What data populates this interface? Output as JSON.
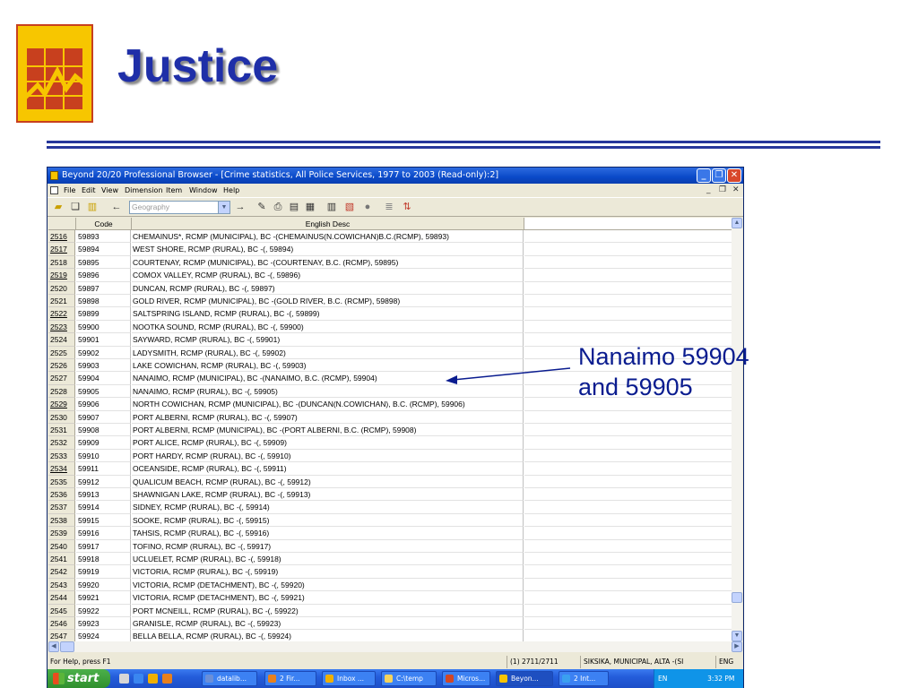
{
  "slide": {
    "title": "Justice",
    "callout_line1": "Nanaimo 59904",
    "callout_line2": "and 59905"
  },
  "window": {
    "title": "Beyond 20/20 Professional Browser - [Crime statistics, All Police Services, 1977 to 2003 (Read-only):2]",
    "menu": [
      "File",
      "Edit",
      "View",
      "Dimension",
      "Item",
      "Window",
      "Help"
    ],
    "dimension_combo": "Geography"
  },
  "grid": {
    "headers": {
      "code": "Code",
      "desc": "English Desc"
    },
    "rows": [
      {
        "num": "2516",
        "code": "59893",
        "desc": "CHEMAINUS*, RCMP (MUNICIPAL), BC -(CHEMAINUS(N.COWICHAN)B.C.(RCMP), 59893)",
        "link": true
      },
      {
        "num": "2517",
        "code": "59894",
        "desc": "WEST SHORE, RCMP (RURAL), BC -(, 59894)",
        "link": true
      },
      {
        "num": "2518",
        "code": "59895",
        "desc": "COURTENAY, RCMP (MUNICIPAL), BC -(COURTENAY, B.C. (RCMP), 59895)",
        "link": false
      },
      {
        "num": "2519",
        "code": "59896",
        "desc": "COMOX VALLEY, RCMP (RURAL), BC -(, 59896)",
        "link": true
      },
      {
        "num": "2520",
        "code": "59897",
        "desc": "DUNCAN, RCMP (RURAL), BC -(, 59897)",
        "link": false
      },
      {
        "num": "2521",
        "code": "59898",
        "desc": "GOLD RIVER, RCMP (MUNICIPAL), BC -(GOLD RIVER, B.C. (RCMP), 59898)",
        "link": false
      },
      {
        "num": "2522",
        "code": "59899",
        "desc": "SALTSPRING ISLAND, RCMP (RURAL), BC -(, 59899)",
        "link": true
      },
      {
        "num": "2523",
        "code": "59900",
        "desc": "NOOTKA SOUND, RCMP (RURAL), BC -(, 59900)",
        "link": true
      },
      {
        "num": "2524",
        "code": "59901",
        "desc": "SAYWARD, RCMP (RURAL), BC -(, 59901)",
        "link": false
      },
      {
        "num": "2525",
        "code": "59902",
        "desc": "LADYSMITH, RCMP (RURAL), BC -(, 59902)",
        "link": false
      },
      {
        "num": "2526",
        "code": "59903",
        "desc": "LAKE COWICHAN, RCMP (RURAL), BC -(, 59903)",
        "link": false
      },
      {
        "num": "2527",
        "code": "59904",
        "desc": "NANAIMO, RCMP (MUNICIPAL), BC -(NANAIMO, B.C. (RCMP), 59904)",
        "link": false
      },
      {
        "num": "2528",
        "code": "59905",
        "desc": "NANAIMO, RCMP (RURAL), BC -(, 59905)",
        "link": false
      },
      {
        "num": "2529",
        "code": "59906",
        "desc": "NORTH COWICHAN, RCMP (MUNICIPAL), BC -(DUNCAN(N.COWICHAN),  B.C. (RCMP), 59906)",
        "link": true
      },
      {
        "num": "2530",
        "code": "59907",
        "desc": "PORT ALBERNI, RCMP (RURAL), BC -(, 59907)",
        "link": false
      },
      {
        "num": "2531",
        "code": "59908",
        "desc": "PORT ALBERNI, RCMP (MUNICIPAL), BC -(PORT ALBERNI, B.C. (RCMP), 59908)",
        "link": false
      },
      {
        "num": "2532",
        "code": "59909",
        "desc": "PORT ALICE, RCMP (RURAL), BC -(, 59909)",
        "link": false
      },
      {
        "num": "2533",
        "code": "59910",
        "desc": "PORT HARDY, RCMP (RURAL), BC -(, 59910)",
        "link": false
      },
      {
        "num": "2534",
        "code": "59911",
        "desc": "OCEANSIDE, RCMP (RURAL), BC -(, 59911)",
        "link": true
      },
      {
        "num": "2535",
        "code": "59912",
        "desc": "QUALICUM BEACH, RCMP (RURAL), BC -(, 59912)",
        "link": false
      },
      {
        "num": "2536",
        "code": "59913",
        "desc": "SHAWNIGAN LAKE, RCMP (RURAL), BC -(, 59913)",
        "link": false
      },
      {
        "num": "2537",
        "code": "59914",
        "desc": "SIDNEY, RCMP (RURAL), BC -(, 59914)",
        "link": false
      },
      {
        "num": "2538",
        "code": "59915",
        "desc": "SOOKE, RCMP (RURAL), BC -(, 59915)",
        "link": false
      },
      {
        "num": "2539",
        "code": "59916",
        "desc": "TAHSIS, RCMP (RURAL), BC -(, 59916)",
        "link": false
      },
      {
        "num": "2540",
        "code": "59917",
        "desc": "TOFINO, RCMP (RURAL), BC -(, 59917)",
        "link": false
      },
      {
        "num": "2541",
        "code": "59918",
        "desc": "UCLUELET, RCMP (RURAL), BC -(, 59918)",
        "link": false
      },
      {
        "num": "2542",
        "code": "59919",
        "desc": "VICTORIA, RCMP (RURAL), BC -(, 59919)",
        "link": false
      },
      {
        "num": "2543",
        "code": "59920",
        "desc": "VICTORIA, RCMP (DETACHMENT), BC -(, 59920)",
        "link": false
      },
      {
        "num": "2544",
        "code": "59921",
        "desc": "VICTORIA, RCMP (DETACHMENT), BC -(, 59921)",
        "link": false
      },
      {
        "num": "2545",
        "code": "59922",
        "desc": "PORT MCNEILL, RCMP (RURAL), BC -(, 59922)",
        "link": false
      },
      {
        "num": "2546",
        "code": "59923",
        "desc": "GRANISLE, RCMP (RURAL), BC -(, 59923)",
        "link": false
      },
      {
        "num": "2547",
        "code": "59924",
        "desc": "BELLA BELLA, RCMP (RURAL), BC -(, 59924)",
        "link": false
      }
    ]
  },
  "statusbar": {
    "help": "For Help, press F1",
    "position": "(1) 2711/2711",
    "current_item": "SIKSIKA, MUNICIPAL, ALTA -(SI",
    "lang": "ENG"
  },
  "taskbar": {
    "start": "start",
    "tasks": [
      {
        "label": "datalib...",
        "icon_color": "#6b8fd8"
      },
      {
        "label": "2 Fir...",
        "icon_color": "#e8801c"
      },
      {
        "label": "Inbox ...",
        "icon_color": "#f0b000"
      },
      {
        "label": "C:\\temp",
        "icon_color": "#f4d35e"
      },
      {
        "label": "Micros...",
        "icon_color": "#d24726"
      },
      {
        "label": "Beyon...",
        "icon_color": "#f6c400",
        "active": true
      },
      {
        "label": "2 Int...",
        "icon_color": "#3aa0f0"
      }
    ],
    "tray_lang": "EN",
    "clock": "3:32 PM"
  }
}
